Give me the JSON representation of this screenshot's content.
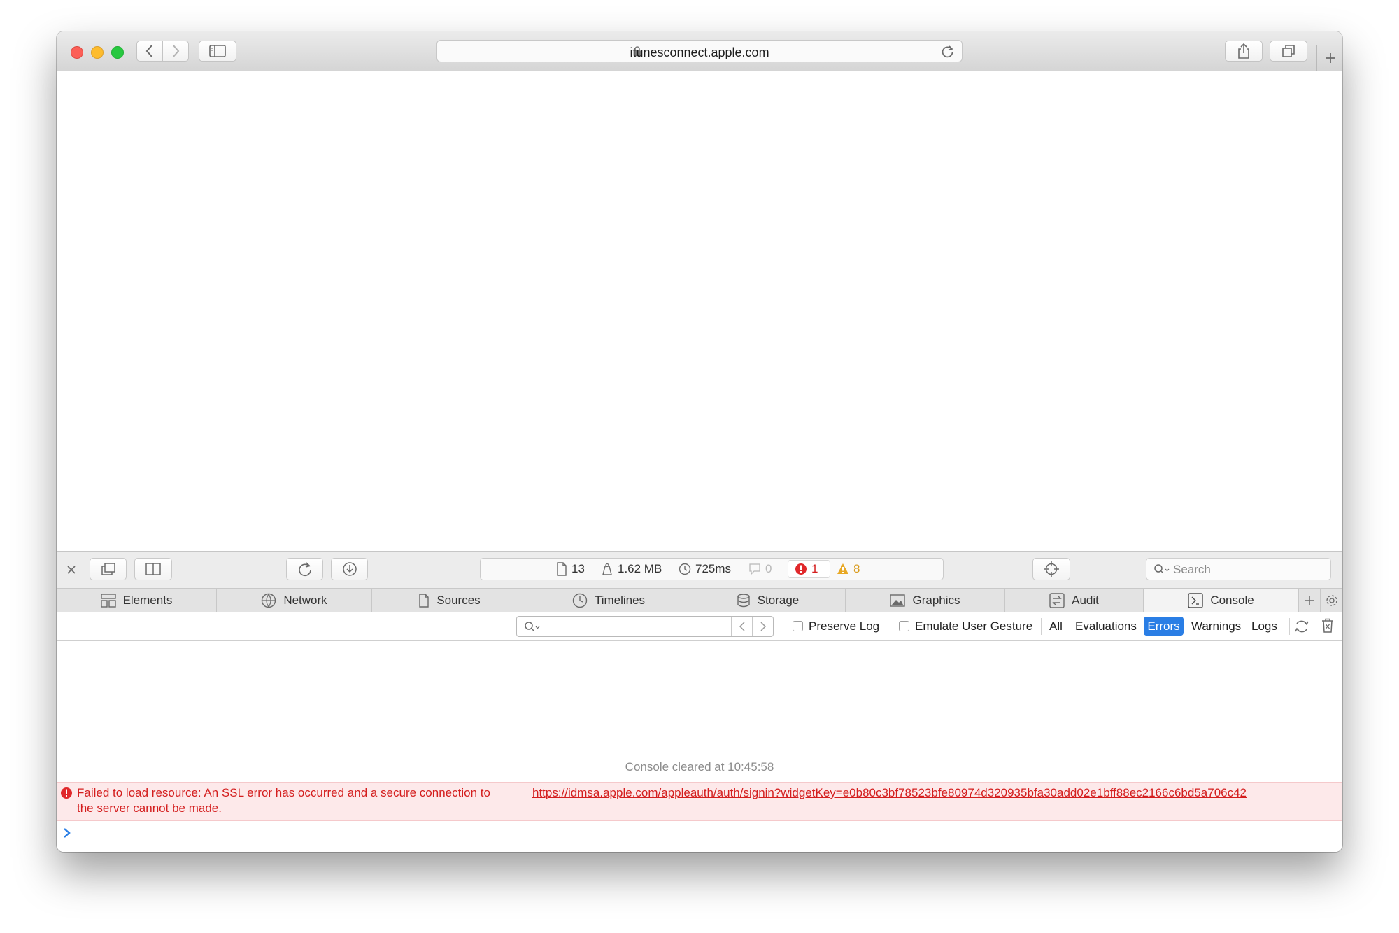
{
  "browser": {
    "url": "itunesconnect.apple.com"
  },
  "inspector": {
    "dashboard": {
      "resources": "13",
      "size": "1.62 MB",
      "time": "725ms",
      "logs": "0",
      "errors": "1",
      "warnings": "8"
    },
    "search_placeholder": "Search",
    "tabs": [
      {
        "label": "Elements",
        "icon": "elements-icon"
      },
      {
        "label": "Network",
        "icon": "network-icon"
      },
      {
        "label": "Sources",
        "icon": "sources-icon"
      },
      {
        "label": "Timelines",
        "icon": "timelines-icon"
      },
      {
        "label": "Storage",
        "icon": "storage-icon"
      },
      {
        "label": "Graphics",
        "icon": "graphics-icon"
      },
      {
        "label": "Audit",
        "icon": "audit-icon"
      },
      {
        "label": "Console",
        "icon": "console-icon"
      }
    ],
    "selected_tab": "Console",
    "filters": {
      "preserve_log": "Preserve Log",
      "emulate_gesture": "Emulate User Gesture",
      "levels": [
        "All",
        "Evaluations",
        "Errors",
        "Warnings",
        "Logs"
      ],
      "selected_level": "Errors"
    },
    "console": {
      "cleared_text": "Console cleared at 10:45:58",
      "error_message_prefix": "Failed to load resource: An SSL error has occurred and a secure connection to",
      "error_url": "https://idmsa.apple.com/appleauth/auth/signin?widgetKey=e0b80c3bf78523bfe80974d320935bfa30add02e1bff88ec2166c6bd5a706c42",
      "error_message_suffix": "the server cannot be made."
    }
  },
  "colors": {
    "accent": "#2a7ee5",
    "error_text": "#d41e1e",
    "error_bg": "#fde9ea",
    "warning": "#e2a21b"
  }
}
